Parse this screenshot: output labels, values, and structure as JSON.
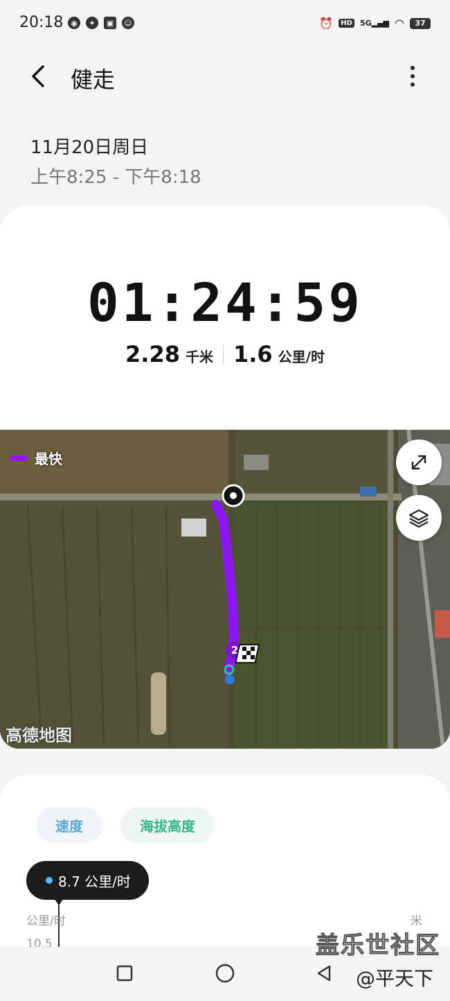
{
  "status_bar": {
    "time": "20:18",
    "network": "5G",
    "hd": "HD",
    "battery": "37"
  },
  "header": {
    "title": "健走"
  },
  "session": {
    "date": "11月20日周日",
    "time_range": "上午8:25 - 下午8:18"
  },
  "summary": {
    "duration": "01:24:59",
    "distance": "2.28",
    "distance_unit": "千米",
    "speed": "1.6",
    "speed_unit": "公里/时"
  },
  "map": {
    "legend_label": "最快",
    "provider_watermark": "高德地图",
    "lap_marker": "2",
    "route_color": "#8b19f0"
  },
  "chart": {
    "tabs": [
      "速度",
      "海拔高度"
    ],
    "tooltip": "8.7 公里/时",
    "left_unit": "公里/时",
    "right_unit": "米",
    "y_tick": "10.5"
  },
  "overlay": {
    "site_watermark": "盖乐世社区",
    "user_watermark": "@平天下"
  },
  "colors": {
    "accent_speed": "#5ca8d8",
    "accent_altitude": "#37b38a",
    "route": "#8b19f0"
  }
}
